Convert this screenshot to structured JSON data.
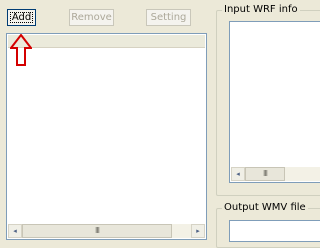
{
  "toolbar": {
    "add_label": "Add",
    "remove_label": "Remove",
    "setting_label": "Setting"
  },
  "panels": {
    "input_info_title": "Input WRF info",
    "output_title": "Output WMV file"
  },
  "scrollbar": {
    "left_arrow": "◂",
    "right_arrow": "▸",
    "thumb_grip": "III"
  },
  "colors": {
    "annotation_arrow": "#d40000",
    "list_border": "#7f9db9",
    "window_bg": "#ece9d8"
  }
}
